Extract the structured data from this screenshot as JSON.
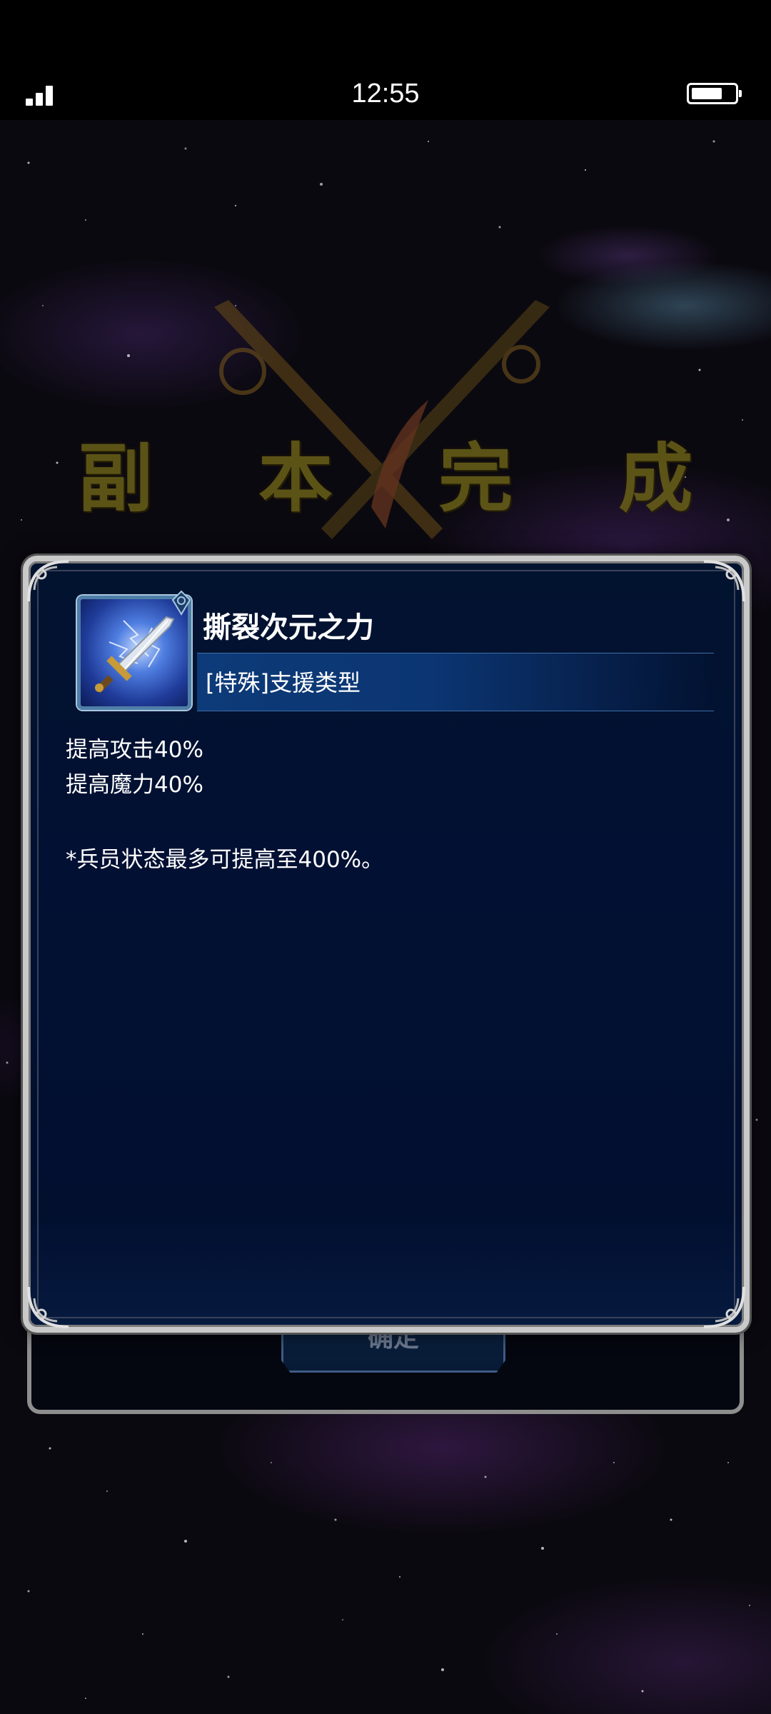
{
  "status_bar": {
    "time": "12:55",
    "icons": [
      "signal-icon",
      "battery-icon"
    ]
  },
  "background": {
    "header_title": "副 本 完 成",
    "back_button_label": "确定"
  },
  "skill_dialog": {
    "icon": "lightning-sword-icon",
    "name": "撕裂次元之力",
    "type": "[特殊]支援类型",
    "effects": [
      "提高攻击40%",
      "提高魔力40%"
    ],
    "note": "*兵员状态最多可提高至400%。"
  },
  "colors": {
    "dialog_bg": "#021033",
    "type_bar": "#0d3a78",
    "frame": "#c9c9c9",
    "title_gold": "#6a6118"
  }
}
